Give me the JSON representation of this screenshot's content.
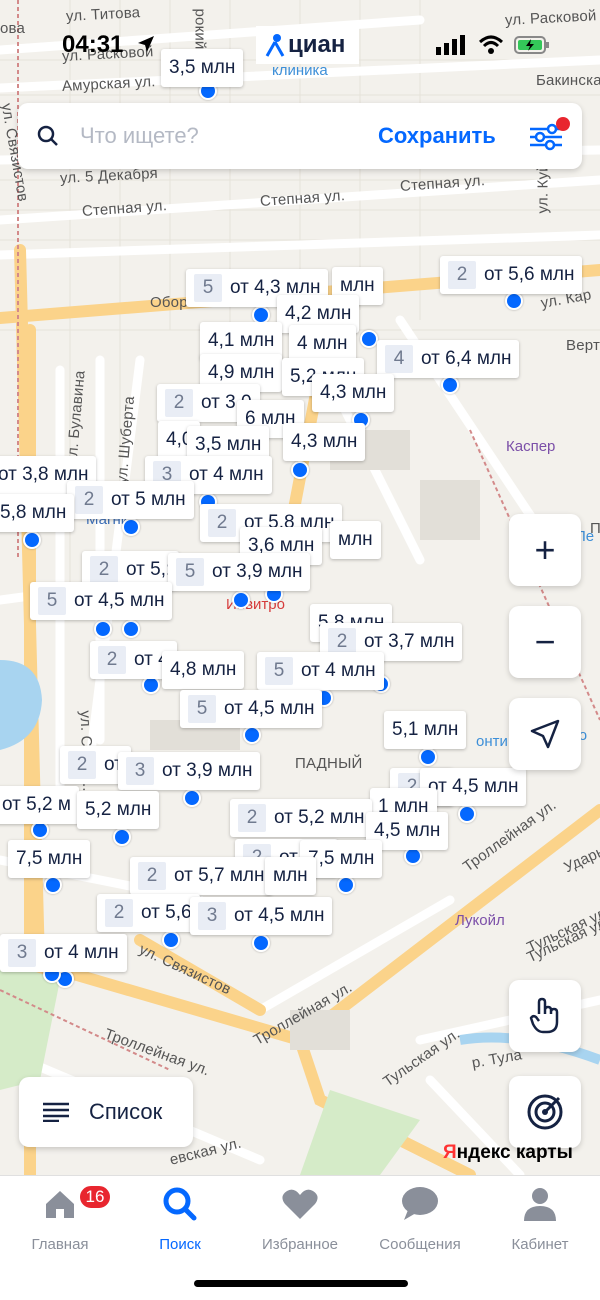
{
  "status": {
    "time": "04:31",
    "app_chip": "циан"
  },
  "search": {
    "placeholder": "Что ищете?",
    "save_label": "Сохранить"
  },
  "streets": [
    {
      "text": "ул. Титова"
    },
    {
      "text": "ул. Расковой"
    },
    {
      "text": "ул. Расковой"
    },
    {
      "text": "Амурская ул."
    },
    {
      "text": "Бакинская"
    },
    {
      "text": "ул. 5 Декабря"
    },
    {
      "text": "Степная ул."
    },
    {
      "text": "Степная ул."
    },
    {
      "text": "Степная ул."
    },
    {
      "text": "ул. Кар"
    },
    {
      "text": "Верт"
    },
    {
      "text": "ул. Булавина"
    },
    {
      "text": "ул. Шуберта"
    },
    {
      "text": "Троллейная ул."
    },
    {
      "text": "Троллейная ул."
    },
    {
      "text": "Троллейная ул."
    },
    {
      "text": "ул. Связистов"
    },
    {
      "text": "Тульская ул."
    },
    {
      "text": "Тульская ул."
    },
    {
      "text": "Тульская ул."
    },
    {
      "text": "Ударн"
    },
    {
      "text": "ул. Связистов"
    },
    {
      "text": "Обор"
    },
    {
      "text": "ПАДНЫЙ"
    },
    {
      "text": "ова"
    },
    {
      "text": "рокий"
    },
    {
      "text": "р. Тула"
    },
    {
      "text": "ул. Куйбыш"
    },
    {
      "text": "ул. Связи..."
    },
    {
      "text": "евская ул."
    },
    {
      "text": "Пе"
    }
  ],
  "pois": [
    {
      "text": "клиника",
      "color": "#3d8fd8"
    },
    {
      "text": "Каспер",
      "color": "#7b4fa8"
    },
    {
      "text": "Инвитро",
      "color": "#d63b3b"
    },
    {
      "text": "Лукойл",
      "color": "#7b4fa8"
    },
    {
      "text": "Магнит",
      "color": "#3d6fb8"
    },
    {
      "text": "онти",
      "color": "#3d8fd8"
    },
    {
      "text": "то",
      "color": "#3d8fd8"
    },
    {
      "text": "Пе",
      "color": "#3d8fd8"
    }
  ],
  "pins": [
    {
      "count": "",
      "price": "3,5 млн"
    },
    {
      "count": "2",
      "price": "от 5,6 млн"
    },
    {
      "count": "5",
      "price": "от 4,3 млн"
    },
    {
      "count": "",
      "price": "млн"
    },
    {
      "count": "",
      "price": "4,2 млн"
    },
    {
      "count": "",
      "price": "4,1 млн"
    },
    {
      "count": "",
      "price": "4 млн"
    },
    {
      "count": "4",
      "price": "от 6,4 млн"
    },
    {
      "count": "",
      "price": "4,9 млн"
    },
    {
      "count": "",
      "price": "5,2 млн"
    },
    {
      "count": "",
      "price": "4,3 млн"
    },
    {
      "count": "2",
      "price": "от 3,0"
    },
    {
      "count": "",
      "price": "6 млн"
    },
    {
      "count": "",
      "price": "4,0"
    },
    {
      "count": "",
      "price": "3,5 млн"
    },
    {
      "count": "",
      "price": "4,3 млн"
    },
    {
      "count": "",
      "price": "от 3,8 млн"
    },
    {
      "count": "3",
      "price": "от 4 млн"
    },
    {
      "count": "2",
      "price": "от 5 млн"
    },
    {
      "count": "",
      "price": "5,8 млн"
    },
    {
      "count": "2",
      "price": "от 5,8 млн"
    },
    {
      "count": "",
      "price": "3,6 млн"
    },
    {
      "count": "",
      "price": "млн"
    },
    {
      "count": "2",
      "price": "от 5,:"
    },
    {
      "count": "5",
      "price": "от 3,9 млн"
    },
    {
      "count": "5",
      "price": "от 4,5 млн"
    },
    {
      "count": "",
      "price": "5,8 млн"
    },
    {
      "count": "2",
      "price": "от 3,7 млн"
    },
    {
      "count": "2",
      "price": "от 4"
    },
    {
      "count": "",
      "price": "4,8 млн"
    },
    {
      "count": "5",
      "price": "от 4 млн"
    },
    {
      "count": "5",
      "price": "от 4,5 млн"
    },
    {
      "count": "",
      "price": "5,1 млн"
    },
    {
      "count": "2",
      "price": "от"
    },
    {
      "count": "3",
      "price": "от 3,9 млн"
    },
    {
      "count": "2",
      "price": "2"
    },
    {
      "count": "",
      "price": "от 4,5 млн"
    },
    {
      "count": "",
      "price": "от 5,2 м"
    },
    {
      "count": "",
      "price": "5,2 млн"
    },
    {
      "count": "",
      "price": "1 млн"
    },
    {
      "count": "2",
      "price": "от 5,2 млн"
    },
    {
      "count": "",
      "price": "4,5 млн"
    },
    {
      "count": "",
      "price": "7,5 млн"
    },
    {
      "count": "2",
      "price": "от 5,6"
    },
    {
      "count": "",
      "price": "7,5 млн"
    },
    {
      "count": "2",
      "price": "от 5,7 млн"
    },
    {
      "count": "",
      "price": "млн"
    },
    {
      "count": "2",
      "price": "от 5,6"
    },
    {
      "count": "3",
      "price": "от 4,5 млн"
    },
    {
      "count": "3",
      "price": "от 4 млн"
    }
  ],
  "map_controls": {
    "zoom_in": "+",
    "zoom_out": "−"
  },
  "list_button": {
    "label": "Список"
  },
  "attribution": {
    "y": "Я",
    "rest": "ндекс карты"
  },
  "tabs": [
    {
      "label": "Главная",
      "badge": "16"
    },
    {
      "label": "Поиск"
    },
    {
      "label": "Избранное"
    },
    {
      "label": "Сообщения"
    },
    {
      "label": "Кабинет"
    }
  ],
  "colors": {
    "accent": "#0468ff",
    "badge": "#e8262f",
    "pin_text": "#152242",
    "major_road": "#fbd38a"
  }
}
